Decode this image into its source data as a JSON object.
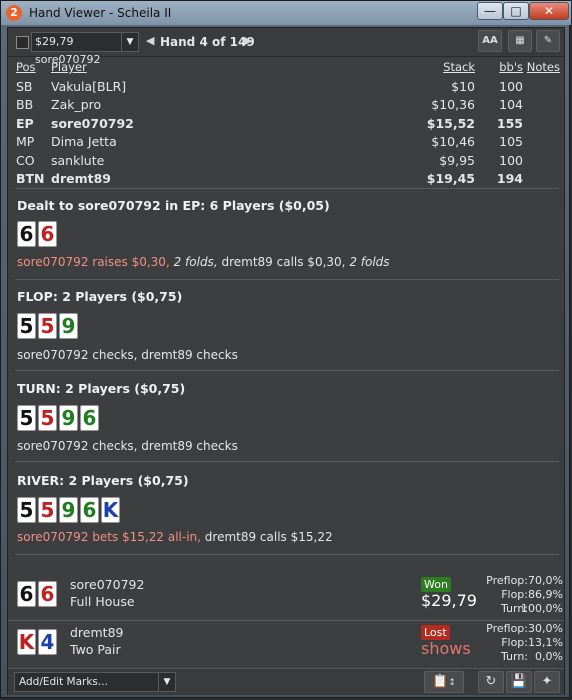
{
  "window": {
    "title": "Hand Viewer - Scheila II",
    "icon_label": "2",
    "controls": [
      "minimize-icon",
      "maximize-icon",
      "close-icon"
    ]
  },
  "toolbar": {
    "hand_select_value": "$29,79 sore070792",
    "hand_counter": "Hand 4 of 149",
    "buttons": [
      "font-size-icon",
      "grid-icon",
      "edit-pencil-icon"
    ],
    "font_button_label": "AA"
  },
  "players_table": {
    "headers": {
      "pos": "Pos",
      "player": "Player",
      "stack": "Stack",
      "bbs": "bb's",
      "notes": "Notes"
    },
    "rows": [
      {
        "pos": "SB",
        "player": "Vakula[BLR]",
        "stack": "$10",
        "bbs": "100",
        "bold": false
      },
      {
        "pos": "BB",
        "player": "Zak_pro",
        "stack": "$10,36",
        "bbs": "104",
        "bold": false
      },
      {
        "pos": "EP",
        "player": "sore070792",
        "stack": "$15,52",
        "bbs": "155",
        "bold": true
      },
      {
        "pos": "MP",
        "player": "Dima Jetta",
        "stack": "$10,46",
        "bbs": "105",
        "bold": false
      },
      {
        "pos": "CO",
        "player": "sanklute",
        "stack": "$9,95",
        "bbs": "100",
        "bold": false
      },
      {
        "pos": "BTN",
        "player": "dremt89",
        "stack": "$19,45",
        "bbs": "194",
        "bold": true
      }
    ]
  },
  "streets": {
    "preflop": {
      "title": "Dealt to sore070792 in EP: 6 Players ($0,05)",
      "cards": [
        {
          "rank": "6",
          "suit": "s"
        },
        {
          "rank": "6",
          "suit": "h"
        }
      ],
      "action_hero": "sore070792 raises $0,30,",
      "action_folds1": "2 folds,",
      "action_rest": "dremt89 calls $0,30,",
      "action_folds2": "2 folds"
    },
    "flop": {
      "title": "FLOP: 2 Players ($0,75)",
      "cards": [
        {
          "rank": "5",
          "suit": "s"
        },
        {
          "rank": "5",
          "suit": "h"
        },
        {
          "rank": "9",
          "suit": "c"
        }
      ],
      "action": "sore070792 checks, dremt89 checks"
    },
    "turn": {
      "title": "TURN: 2 Players ($0,75)",
      "cards": [
        {
          "rank": "5",
          "suit": "s"
        },
        {
          "rank": "5",
          "suit": "h"
        },
        {
          "rank": "9",
          "suit": "c"
        },
        {
          "rank": "6",
          "suit": "c"
        }
      ],
      "action": "sore070792 checks, dremt89 checks"
    },
    "river": {
      "title": "RIVER: 2 Players ($0,75)",
      "cards": [
        {
          "rank": "5",
          "suit": "s"
        },
        {
          "rank": "5",
          "suit": "h"
        },
        {
          "rank": "9",
          "suit": "c"
        },
        {
          "rank": "6",
          "suit": "c"
        },
        {
          "rank": "K",
          "suit": "d"
        }
      ],
      "action_hero": "sore070792 bets $15,22 all-in,",
      "action_rest": "dremt89 calls $15,22"
    }
  },
  "results": [
    {
      "player": "sore070792",
      "hand": "Full House",
      "cards": [
        {
          "rank": "6",
          "suit": "s"
        },
        {
          "rank": "6",
          "suit": "h"
        }
      ],
      "badge": "Won",
      "amount": "$29,79",
      "equity": [
        {
          "label": "Preflop:",
          "value": "70,0%"
        },
        {
          "label": "Flop:",
          "value": "86,9%"
        },
        {
          "label": "Turn:",
          "value": "100,0%"
        }
      ]
    },
    {
      "player": "dremt89",
      "hand": "Two Pair",
      "cards": [
        {
          "rank": "K",
          "suit": "h"
        },
        {
          "rank": "4",
          "suit": "d"
        }
      ],
      "badge": "Lost",
      "amount": "shows",
      "equity": [
        {
          "label": "Preflop:",
          "value": "30,0%"
        },
        {
          "label": "Flop:",
          "value": "13,1%"
        },
        {
          "label": "Turn:",
          "value": "0,0%"
        }
      ]
    }
  ],
  "bottombar": {
    "marks_placeholder": "Add/Edit Marks...",
    "buttons": [
      "clipboard-icon",
      "sort-arrows-icon",
      "refresh-icon",
      "save-icon",
      "twitter-icon"
    ]
  },
  "colors": {
    "spade": "#111111",
    "heart": "#c02020",
    "club": "#1f7d1f",
    "diamond": "#1c3fb0",
    "hero_action": "#f29082",
    "won_badge": "#2f7d22",
    "lost_badge": "#b32a20"
  }
}
